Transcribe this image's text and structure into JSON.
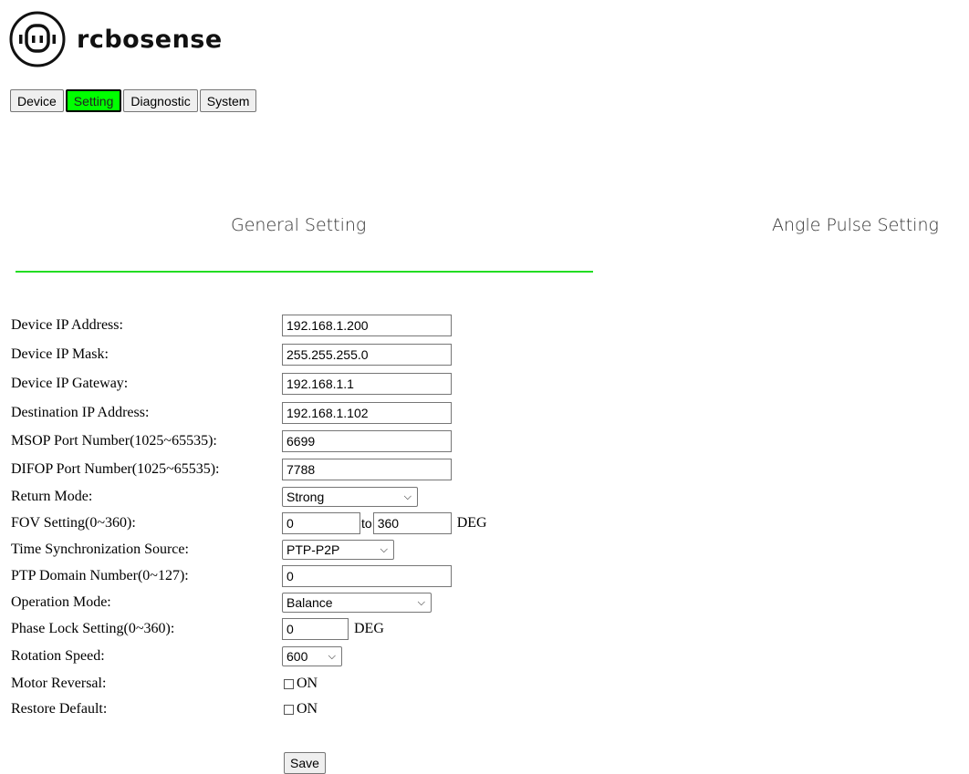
{
  "brand": {
    "name": "rcbosense"
  },
  "nav": {
    "tabs": [
      "Device",
      "Setting",
      "Diagnostic",
      "System"
    ],
    "active": "Setting",
    "active_color": "#00ff00"
  },
  "tabs": {
    "general": "General Setting",
    "pulse": "Angle Pulse Setting",
    "underline_color": "#22dd22"
  },
  "form": {
    "ip_address": {
      "label": "Device IP Address:",
      "value": "192.168.1.200"
    },
    "ip_mask": {
      "label": "Device IP Mask:",
      "value": "255.255.255.0"
    },
    "gateway": {
      "label": "Device IP Gateway:",
      "value": "192.168.1.1"
    },
    "dest_ip": {
      "label": "Destination IP Address:",
      "value": "192.168.1.102"
    },
    "msop": {
      "label": "MSOP Port Number(1025~65535):",
      "value": "6699"
    },
    "difop": {
      "label": "DIFOP Port Number(1025~65535):",
      "value": "7788"
    },
    "return_mode": {
      "label": "Return Mode:",
      "value": "Strong"
    },
    "fov": {
      "label": "FOV Setting(0~360):",
      "from": "0",
      "to_label": "to",
      "to": "360",
      "unit": "DEG"
    },
    "time_sync": {
      "label": "Time Synchronization Source:",
      "value": "PTP-P2P"
    },
    "ptp_domain": {
      "label": "PTP Domain Number(0~127):",
      "value": "0"
    },
    "operation_mode": {
      "label": "Operation Mode:",
      "value": "Balance"
    },
    "phase_lock": {
      "label": "Phase Lock Setting(0~360):",
      "value": "0",
      "unit": "DEG"
    },
    "rotation_speed": {
      "label": "Rotation Speed:",
      "value": "600"
    },
    "motor_reversal": {
      "label": "Motor Reversal:",
      "option": "ON"
    },
    "restore_default": {
      "label": "Restore Default:",
      "option": "ON"
    },
    "save_label": "Save"
  }
}
